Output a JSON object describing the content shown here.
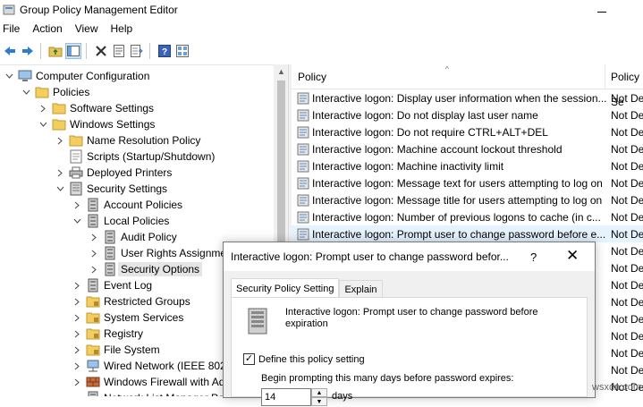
{
  "window": {
    "title": "Group Policy Management Editor"
  },
  "menu": [
    "File",
    "Action",
    "View",
    "Help"
  ],
  "tree": [
    {
      "label": "Computer Configuration",
      "indent": 0,
      "chevron": "down",
      "icon": "computer-icon"
    },
    {
      "label": "Policies",
      "indent": 1,
      "chevron": "down",
      "icon": "folder-icon"
    },
    {
      "label": "Software Settings",
      "indent": 2,
      "chevron": "right",
      "icon": "folder-icon"
    },
    {
      "label": "Windows Settings",
      "indent": 2,
      "chevron": "down",
      "icon": "folder-icon"
    },
    {
      "label": "Name Resolution Policy",
      "indent": 3,
      "chevron": "right",
      "icon": "folder-icon"
    },
    {
      "label": "Scripts (Startup/Shutdown)",
      "indent": 3,
      "chevron": "none",
      "icon": "scripts-icon"
    },
    {
      "label": "Deployed Printers",
      "indent": 3,
      "chevron": "right",
      "icon": "printer-icon"
    },
    {
      "label": "Security Settings",
      "indent": 3,
      "chevron": "down",
      "icon": "security-icon"
    },
    {
      "label": "Account Policies",
      "indent": 4,
      "chevron": "right",
      "icon": "policy-icon"
    },
    {
      "label": "Local Policies",
      "indent": 4,
      "chevron": "down",
      "icon": "policy-icon"
    },
    {
      "label": "Audit Policy",
      "indent": 5,
      "chevron": "right",
      "icon": "policy-icon"
    },
    {
      "label": "User Rights Assignme",
      "indent": 5,
      "chevron": "right",
      "icon": "policy-icon"
    },
    {
      "label": "Security Options",
      "indent": 5,
      "chevron": "right",
      "icon": "policy-icon",
      "selected": true
    },
    {
      "label": "Event Log",
      "indent": 4,
      "chevron": "right",
      "icon": "policy-icon"
    },
    {
      "label": "Restricted Groups",
      "indent": 4,
      "chevron": "right",
      "icon": "lock-folder-icon"
    },
    {
      "label": "System Services",
      "indent": 4,
      "chevron": "right",
      "icon": "lock-folder-icon"
    },
    {
      "label": "Registry",
      "indent": 4,
      "chevron": "right",
      "icon": "lock-folder-icon"
    },
    {
      "label": "File System",
      "indent": 4,
      "chevron": "right",
      "icon": "lock-folder-icon"
    },
    {
      "label": "Wired Network (IEEE 802.3",
      "indent": 4,
      "chevron": "right",
      "icon": "network-icon"
    },
    {
      "label": "Windows Firewall with Ad",
      "indent": 4,
      "chevron": "right",
      "icon": "firewall-icon"
    },
    {
      "label": "Network List Manager Po",
      "indent": 4,
      "chevron": "none",
      "icon": "policy-icon"
    }
  ],
  "list": {
    "col_policy": "Policy",
    "col_setting": "Policy Se",
    "rows": [
      {
        "name": "Interactive logon: Display user information when the session...",
        "value": "Not De"
      },
      {
        "name": "Interactive logon: Do not display last user name",
        "value": "Not De"
      },
      {
        "name": "Interactive logon: Do not require CTRL+ALT+DEL",
        "value": "Not De"
      },
      {
        "name": "Interactive logon: Machine account lockout threshold",
        "value": "Not De"
      },
      {
        "name": "Interactive logon: Machine inactivity limit",
        "value": "Not De"
      },
      {
        "name": "Interactive logon: Message text for users attempting to log on",
        "value": "Not De"
      },
      {
        "name": "Interactive logon: Message title for users attempting to log on",
        "value": "Not De"
      },
      {
        "name": "Interactive logon: Number of previous logons to cache (in c...",
        "value": "Not De"
      },
      {
        "name": "Interactive logon: Prompt user to change password before e...",
        "value": "Not De",
        "selected": true
      },
      {
        "name": "",
        "value": "Not De"
      },
      {
        "name": "",
        "value": "Not De"
      },
      {
        "name": "",
        "value": "Not De"
      },
      {
        "name": "",
        "value": "Not De"
      },
      {
        "name": "",
        "value": "Not De"
      },
      {
        "name": "",
        "value": "Not De"
      },
      {
        "name": "",
        "value": "Not De"
      },
      {
        "name": "",
        "value": "Not De"
      },
      {
        "name": "",
        "value": "Not De"
      },
      {
        "name": "",
        "value": "Not De"
      }
    ]
  },
  "dialog": {
    "title": "Interactive logon: Prompt user to change password befor...",
    "help": "?",
    "close": "✕",
    "tabs": [
      "Security Policy Setting",
      "Explain"
    ],
    "description": "Interactive logon: Prompt user to change password before expiration",
    "checkbox_label": "Define this policy setting",
    "checkbox_checked": true,
    "prompt": "Begin prompting this many days before password expires:",
    "days_value": "14",
    "unit": "days"
  },
  "watermark": "wsxdn.com"
}
